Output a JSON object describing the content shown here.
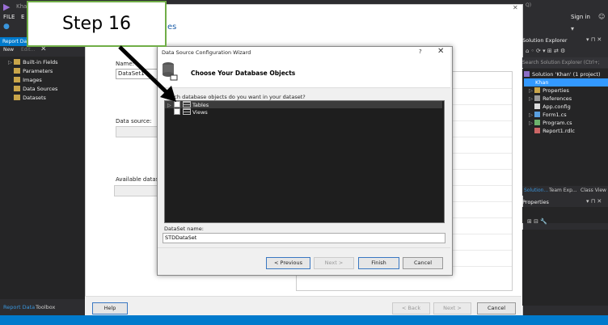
{
  "top": {
    "app_name_partial": "Kha",
    "menu": [
      "FILE",
      "E"
    ],
    "sign_in": "Sign in",
    "quick_launch_partial": "Q)"
  },
  "left_panel": {
    "tab": "Report Data",
    "toolbar_new": "New",
    "toolbar_edit": "Edit...",
    "items": [
      "Built-in Fields",
      "Parameters",
      "Images",
      "Data Sources",
      "Datasets"
    ],
    "bottom_tabs": [
      "Report Data",
      "Toolbox"
    ]
  },
  "props_dialog": {
    "title_partial": "es",
    "name_label": "Name:",
    "name_value": "DataSet1",
    "datasource_label": "Data source:",
    "available_label": "Available datasets:",
    "help": "Help",
    "back": "< Back",
    "next": "Next >",
    "cancel": "Cancel"
  },
  "wizard": {
    "title": "Data Source Configuration Wizard",
    "help": "?",
    "close": "✕",
    "heading": "Choose Your Database Objects",
    "question": "Which database objects do you want in your dataset?",
    "objects": [
      "Tables",
      "Views"
    ],
    "dataset_name_label": "DataSet name:",
    "dataset_name_value": "STDDataSet",
    "prev": "< Previous",
    "next": "Next >",
    "finish": "Finish",
    "cancel": "Cancel"
  },
  "solution_explorer": {
    "title": "Solution Explorer",
    "search_placeholder": "Search Solution Explorer (Ctrl+;",
    "items": [
      {
        "label": "Solution 'Khan' (1 project)",
        "indent": 0
      },
      {
        "label": "Khan",
        "indent": 1,
        "selected": true
      },
      {
        "label": "Properties",
        "indent": 2
      },
      {
        "label": "References",
        "indent": 2
      },
      {
        "label": "App.config",
        "indent": 2
      },
      {
        "label": "Form1.cs",
        "indent": 2
      },
      {
        "label": "Program.cs",
        "indent": 2
      },
      {
        "label": "Report1.rdlc",
        "indent": 2
      }
    ],
    "tabs": [
      "Solution...",
      "Team Exp...",
      "Class View"
    ]
  },
  "properties_panel": {
    "title": "Properties"
  },
  "callout": {
    "text": "Step 16"
  },
  "colors": {
    "accent": "#007acc",
    "callout_border": "#70ad47",
    "selection": "#3399ff"
  }
}
